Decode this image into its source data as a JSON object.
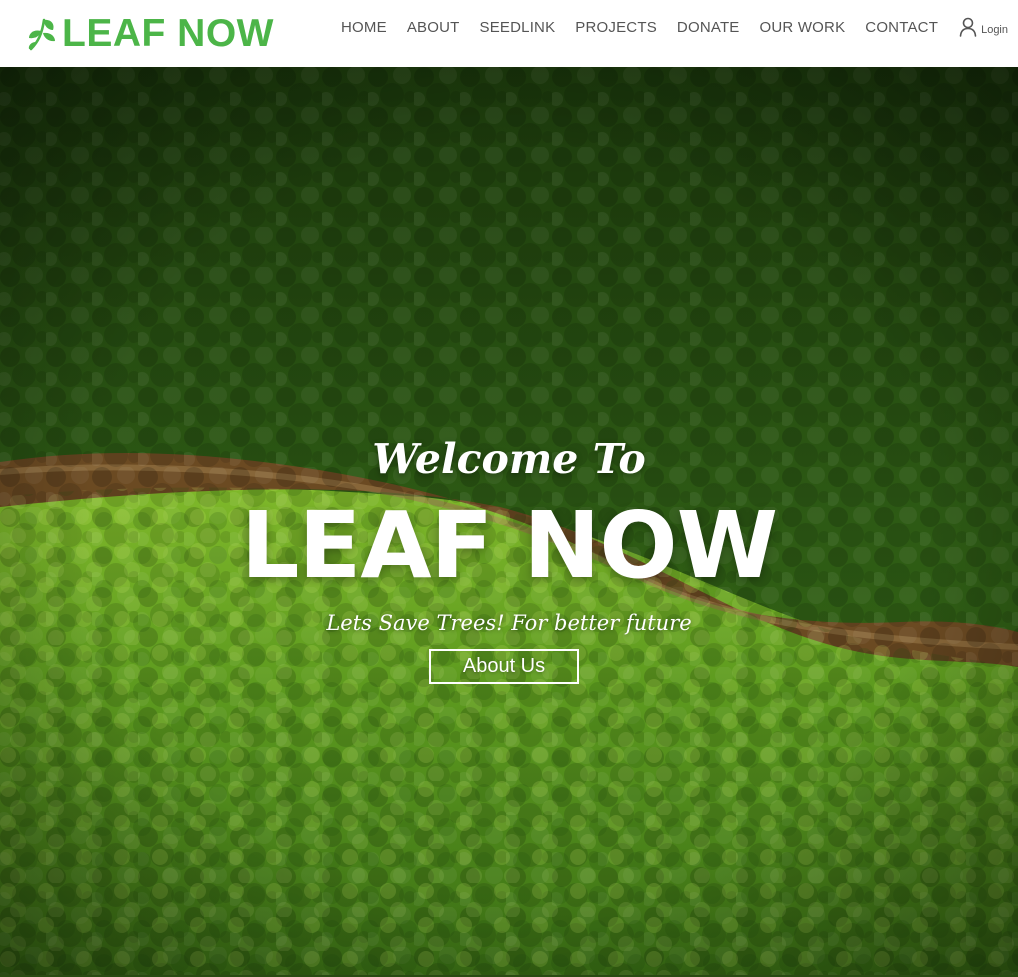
{
  "brand": {
    "name": "LEAF NOW",
    "icon": "leaf-sprout-icon",
    "color": "#4cb548"
  },
  "nav": {
    "items": [
      {
        "label": "HOME"
      },
      {
        "label": "ABOUT"
      },
      {
        "label": "SEEDLINK"
      },
      {
        "label": "PROJECTS"
      },
      {
        "label": "DONATE"
      },
      {
        "label": "OUR WORK"
      },
      {
        "label": "CONTACT"
      }
    ],
    "login": {
      "label": "Login",
      "icon": "user-icon"
    }
  },
  "hero": {
    "welcome": "Welcome To",
    "title": "LEAF NOW",
    "tagline": "Lets Save Trees! For better future",
    "button_label": "About Us",
    "background": "aerial-forest-river-image"
  }
}
